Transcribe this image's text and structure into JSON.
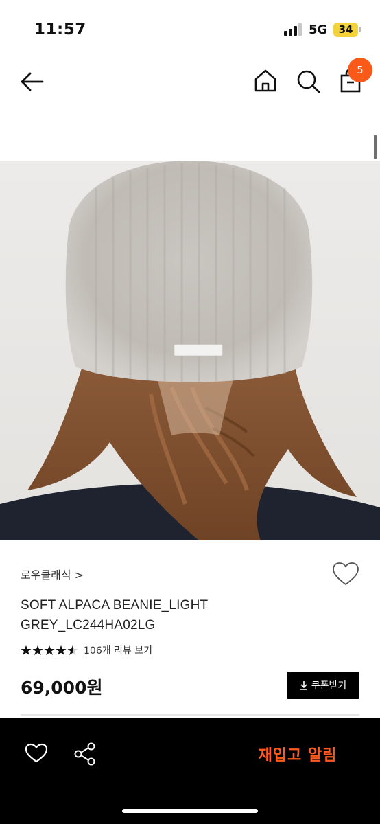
{
  "status_bar": {
    "time": "11:57",
    "network": "5G",
    "battery": "34"
  },
  "header": {
    "back_icon": "arrow-left-icon",
    "home_icon": "home-icon",
    "search_icon": "search-icon",
    "cart_icon": "shopping-bag-icon",
    "cart_count": "5"
  },
  "product": {
    "image_description_icon": "product-photo",
    "brand": "로우클래식 >",
    "name": "SOFT ALPACA BEANIE_LIGHT GREY_LC244HA02LG",
    "rating": 4.5,
    "rating_max": 5,
    "review_link": "106개 리뷰 보기",
    "price": "69,000원",
    "coupon_label": "쿠폰받기"
  },
  "bottom_bar": {
    "like_icon": "heart-icon",
    "share_icon": "share-icon",
    "restock_label": "재입고 알림"
  },
  "colors": {
    "accent": "#fa5a19",
    "restock": "#ff5a1f",
    "bottom_bar": "#000000"
  }
}
